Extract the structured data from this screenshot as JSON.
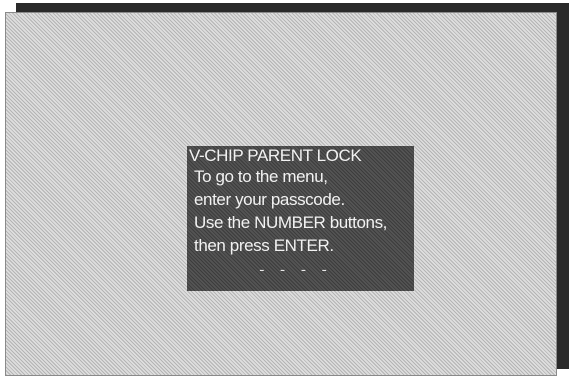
{
  "osd": {
    "title": "V-CHIP PARENT LOCK",
    "lines": [
      "To go to the menu,",
      "enter your passcode.",
      "Use the NUMBER buttons,",
      "then press ENTER."
    ],
    "passcode_placeholder": "- - - -"
  }
}
